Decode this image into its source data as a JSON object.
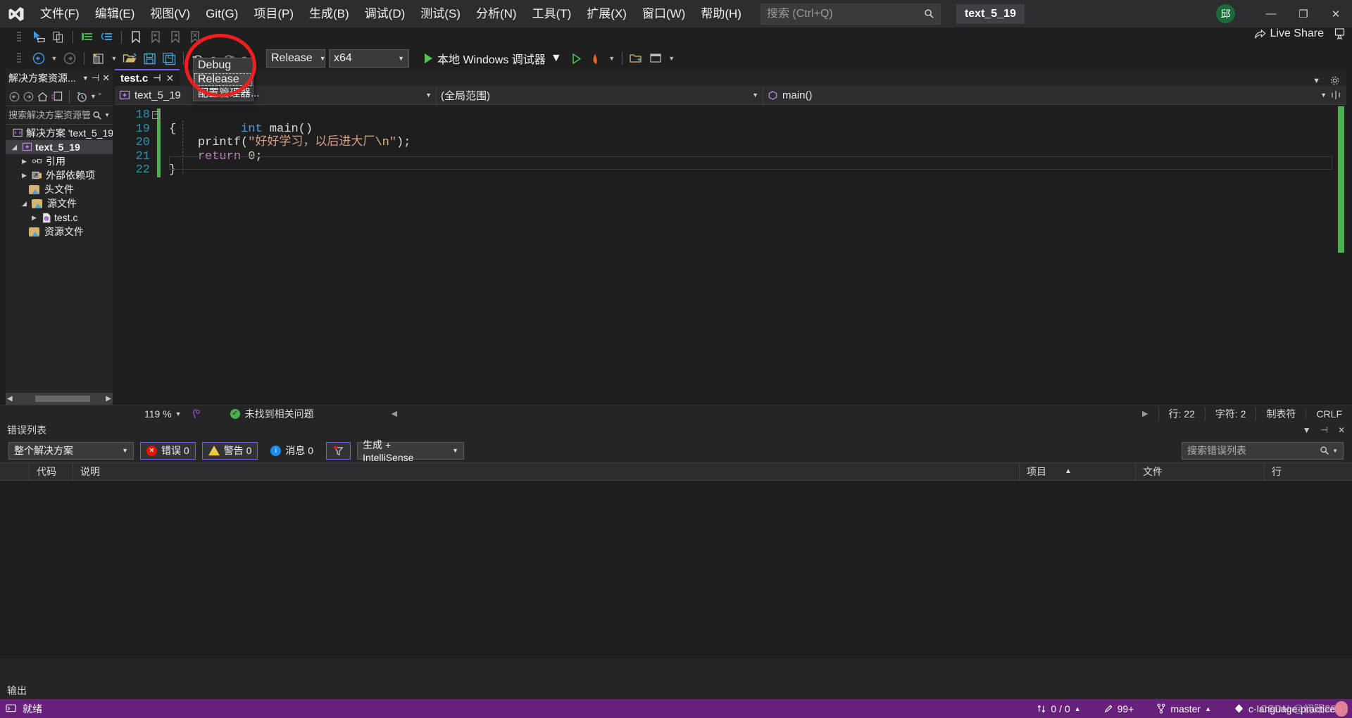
{
  "window": {
    "project_chip": "text_5_19",
    "avatar_initial": "邱",
    "minimize": "—",
    "maximize": "❐",
    "close": "✕",
    "live_share": "Live Share"
  },
  "menubar": {
    "items": [
      {
        "label": "文件(F)",
        "name": "menu-file"
      },
      {
        "label": "编辑(E)",
        "name": "menu-edit"
      },
      {
        "label": "视图(V)",
        "name": "menu-view"
      },
      {
        "label": "Git(G)",
        "name": "menu-git"
      },
      {
        "label": "项目(P)",
        "name": "menu-project"
      },
      {
        "label": "生成(B)",
        "name": "menu-build"
      },
      {
        "label": "调试(D)",
        "name": "menu-debug"
      },
      {
        "label": "测试(S)",
        "name": "menu-test"
      },
      {
        "label": "分析(N)",
        "name": "menu-analyze"
      },
      {
        "label": "工具(T)",
        "name": "menu-tools"
      },
      {
        "label": "扩展(X)",
        "name": "menu-extensions"
      },
      {
        "label": "窗口(W)",
        "name": "menu-window"
      },
      {
        "label": "帮助(H)",
        "name": "menu-help"
      }
    ]
  },
  "search": {
    "placeholder": "搜索 (Ctrl+Q)",
    "value": ""
  },
  "toolbar": {
    "configuration": "Release",
    "platform": "x64",
    "debug_target": "本地 Windows 调试器",
    "dropdown": {
      "open": true,
      "options": [
        "Debug",
        "Release",
        "配置管理器..."
      ],
      "selected": "Release"
    }
  },
  "solution_explorer": {
    "title": "解决方案资源...",
    "search_placeholder": "搜索解决方案资源管",
    "tree": [
      {
        "label": "解决方案 'text_5_19",
        "indent": 0,
        "twisty": "",
        "icon": "solution-icon",
        "bold": false
      },
      {
        "label": "text_5_19",
        "indent": 0,
        "twisty": "▲",
        "icon": "project-icon",
        "bold": true,
        "selected": true
      },
      {
        "label": "引用",
        "indent": 1,
        "twisty": "▶",
        "icon": "references-icon",
        "bold": false
      },
      {
        "label": "外部依赖项",
        "indent": 1,
        "twisty": "▶",
        "icon": "ext-deps-icon",
        "bold": false
      },
      {
        "label": "头文件",
        "indent": 1,
        "twisty": "",
        "icon": "filter-folder-icon",
        "bold": false
      },
      {
        "label": "源文件",
        "indent": 1,
        "twisty": "▲",
        "icon": "filter-folder-icon",
        "bold": false
      },
      {
        "label": "test.c",
        "indent": 2,
        "twisty": "▶",
        "icon": "c-file-icon",
        "bold": false
      },
      {
        "label": "资源文件",
        "indent": 1,
        "twisty": "",
        "icon": "filter-folder-icon",
        "bold": false
      }
    ]
  },
  "editor": {
    "tab_label": "test.c",
    "tab_close": "✕",
    "nav": {
      "project": "text_5_19",
      "scope": "(全局范围)",
      "member": "main()"
    },
    "lines": [
      {
        "no": "18",
        "html": "int main()"
      },
      {
        "no": "19",
        "html": "{"
      },
      {
        "no": "20",
        "html": "printf(\"好好学习，以后进大厂\\n\");"
      },
      {
        "no": "21",
        "html": "return 0;"
      },
      {
        "no": "22",
        "html": "}"
      }
    ]
  },
  "editor_status": {
    "zoom": "119 %",
    "issues": "未找到相关问题",
    "line": "行: 22",
    "column": "字符: 2",
    "tabs": "制表符",
    "eol": "CRLF"
  },
  "error_list": {
    "title": "错误列表",
    "scope": "整个解决方案",
    "errors": "错误 0",
    "warnings": "警告 0",
    "messages": "消息 0",
    "build_filter": "生成 + IntelliSense",
    "search_placeholder": "搜索错误列表",
    "columns": [
      "",
      "代码",
      "说明",
      "项目",
      "文件",
      "行"
    ],
    "rows": []
  },
  "output": {
    "title": "输出"
  },
  "statusbar": {
    "ready": "就绪",
    "sync": "0 / 0",
    "pending_changes": "99+",
    "branch": "master",
    "repo": "c-language-practice"
  },
  "watermark": {
    "text": "CSDN @初阳285"
  }
}
